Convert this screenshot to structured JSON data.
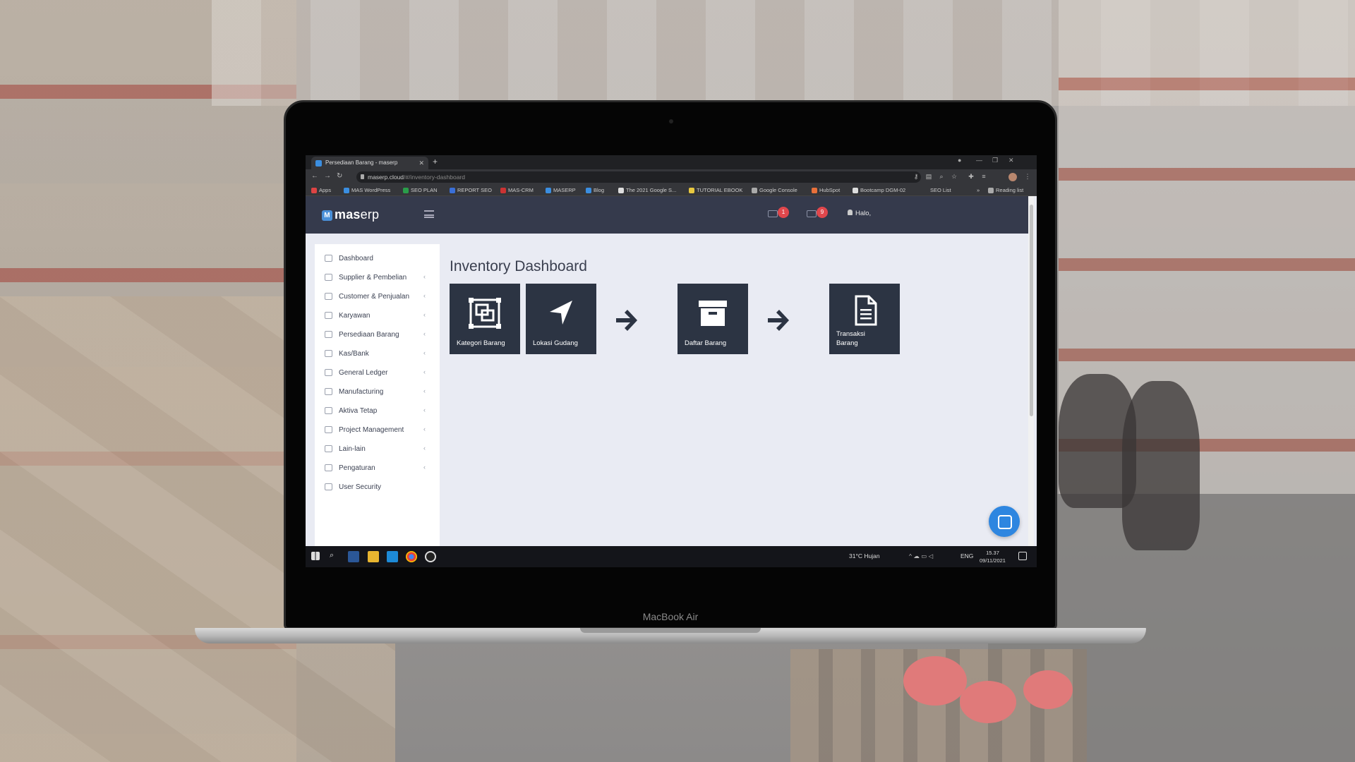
{
  "browser": {
    "tab_title": "Persediaan Barang - maserp",
    "url_host": "maserp.cloud",
    "url_path": "/#/inventory-dashboard",
    "bookmarks": [
      "Apps",
      "MAS WordPress",
      "SEO PLAN",
      "REPORT SEO",
      "MAS-CRM",
      "MASERP",
      "Blog",
      "The 2021 Google S...",
      "TUTORIAL EBOOK",
      "Google Console",
      "HubSpot",
      "Bootcamp DGM-02",
      "SEO List",
      "»",
      "Reading list"
    ]
  },
  "app": {
    "logo_prefix": "mas",
    "logo_suffix": "erp",
    "logo_mark": "M",
    "badges": {
      "first": "1",
      "second": "9"
    },
    "greeting": "Halo,"
  },
  "sidebar": {
    "items": [
      {
        "label": "Dashboard",
        "icon": "home-icon",
        "chevron": ""
      },
      {
        "label": "Supplier & Pembelian",
        "icon": "cart-icon",
        "chevron": "‹"
      },
      {
        "label": "Customer & Penjualan",
        "icon": "card-icon",
        "chevron": "‹"
      },
      {
        "label": "Karyawan",
        "icon": "id-card-icon",
        "chevron": "‹"
      },
      {
        "label": "Persediaan Barang",
        "icon": "tag-icon",
        "chevron": "‹"
      },
      {
        "label": "Kas/Bank",
        "icon": "wallet-icon",
        "chevron": "‹"
      },
      {
        "label": "General Ledger",
        "icon": "book-icon",
        "chevron": "‹"
      },
      {
        "label": "Manufacturing",
        "icon": "factory-icon",
        "chevron": "‹"
      },
      {
        "label": "Aktiva Tetap",
        "icon": "car-icon",
        "chevron": "‹"
      },
      {
        "label": "Project Management",
        "icon": "clipboard-icon",
        "chevron": "‹"
      },
      {
        "label": "Lain-lain",
        "icon": "list-icon",
        "chevron": "‹"
      },
      {
        "label": "Pengaturan",
        "icon": "gear-icon",
        "chevron": "‹"
      },
      {
        "label": "User Security",
        "icon": "lock-icon",
        "chevron": ""
      }
    ]
  },
  "main": {
    "title": "Inventory Dashboard",
    "tiles": [
      {
        "label": "Kategori Barang",
        "icon": "object-group-icon"
      },
      {
        "label": "Lokasi Gudang",
        "icon": "location-arrow-icon"
      },
      {
        "label": "Daftar Barang",
        "icon": "archive-icon"
      },
      {
        "label": "Transaksi Barang",
        "icon": "document-icon"
      }
    ]
  },
  "taskbar": {
    "weather": "31°C  Hujan",
    "lang": "ENG",
    "time": "15.37",
    "date": "09/11/2021"
  },
  "device": {
    "label": "MacBook Air"
  },
  "colors": {
    "topbar": "#353a4c",
    "tile": "#2c3443",
    "content_bg": "#e9ebf3",
    "badge": "#e0474c",
    "chat": "#2e86e0"
  }
}
